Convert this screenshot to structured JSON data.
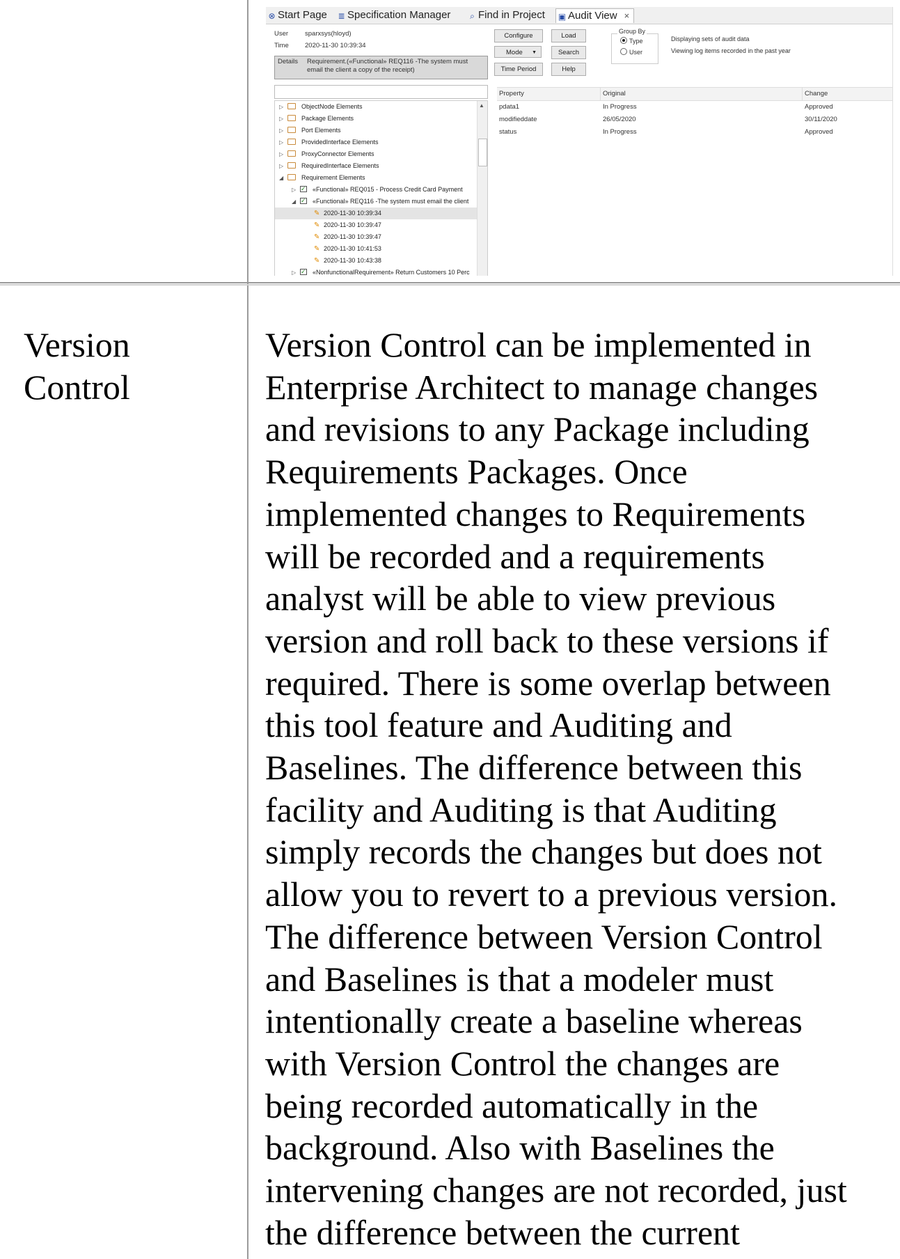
{
  "screenshot": {
    "tabs": [
      {
        "icon": "start-page-icon",
        "glyph": "⊗",
        "label": "Start Page"
      },
      {
        "icon": "spec-manager-icon",
        "glyph": "≣",
        "label": "Specification Manager"
      },
      {
        "icon": "find-in-project-icon",
        "glyph": "⌕",
        "label": "Find in Project"
      },
      {
        "icon": "audit-view-icon",
        "glyph": "▣",
        "label": "Audit View",
        "close": "×"
      }
    ],
    "info": {
      "user_label": "User",
      "user_value": "sparxsys(hloyd)",
      "time_label": "Time",
      "time_value": "2020-11-30 10:39:34",
      "details_label": "Details",
      "details_value": "Requirement.(«Functional» REQ116 -The system must email the client a copy of the receipt)"
    },
    "buttons": {
      "configure": "Configure",
      "load": "Load",
      "mode": "Mode",
      "search": "Search",
      "time_period": "Time Period",
      "help": "Help"
    },
    "group_by": {
      "title": "Group By",
      "type": "Type",
      "user": "User"
    },
    "messages": [
      "Displaying sets of audit data",
      "Viewing log items recorded in the past year"
    ],
    "tree": [
      {
        "kind": "folder",
        "label": "ObjectNode Elements"
      },
      {
        "kind": "folder",
        "label": "Package Elements"
      },
      {
        "kind": "folder",
        "label": "Port Elements"
      },
      {
        "kind": "folder",
        "label": "ProvidedInterface Elements"
      },
      {
        "kind": "folder",
        "label": "ProxyConnector Elements"
      },
      {
        "kind": "folder",
        "label": "RequiredInterface Elements"
      },
      {
        "kind": "folder-open",
        "label": "Requirement Elements"
      },
      {
        "kind": "req",
        "label": "«Functional» REQ015 - Process Credit Card Payment"
      },
      {
        "kind": "req-open",
        "label": "«Functional» REQ116 -The system must email the client"
      },
      {
        "kind": "entry",
        "label": "2020-11-30 10:39:34"
      },
      {
        "kind": "entry",
        "label": "2020-11-30 10:39:47"
      },
      {
        "kind": "entry",
        "label": "2020-11-30 10:39:47"
      },
      {
        "kind": "entry",
        "label": "2020-11-30 10:41:53"
      },
      {
        "kind": "entry",
        "label": "2020-11-30 10:43:38"
      },
      {
        "kind": "req",
        "label": "«NonfunctionalRequirement» Return Customers 10 Perc"
      }
    ],
    "grid": {
      "headers": [
        "Property",
        "Original",
        "Change"
      ],
      "rows": [
        [
          "pdata1",
          "In Progress",
          "Approved"
        ],
        [
          "modifieddate",
          "26/05/2020",
          "30/11/2020"
        ],
        [
          "status",
          "In Progress",
          "Approved"
        ]
      ]
    }
  },
  "row": {
    "label": "Version\nControl",
    "lines": [
      "Version Control can be implemented in",
      "Enterprise Architect to manage changes",
      "and revisions to any Package including",
      "Requirements Packages. Once",
      "implemented changes to Requirements",
      "will be recorded and a requirements",
      "analyst will be able to view previous",
      "version and roll back to these versions if",
      "required. There is some overlap between",
      "this tool feature and Auditing and",
      "Baselines. The difference between this",
      "facility and Auditing is that Auditing",
      "simply records the changes but does not",
      "allow you to revert to a previous version.",
      "The difference between Version Control",
      "and Baselines is that a modeler must",
      "intentionally create a baseline whereas",
      "with Version Control the changes are",
      "being recorded automatically in the",
      "background. Also with Baselines the",
      "intervening changes are not recorded, just",
      "the difference between the current"
    ]
  }
}
